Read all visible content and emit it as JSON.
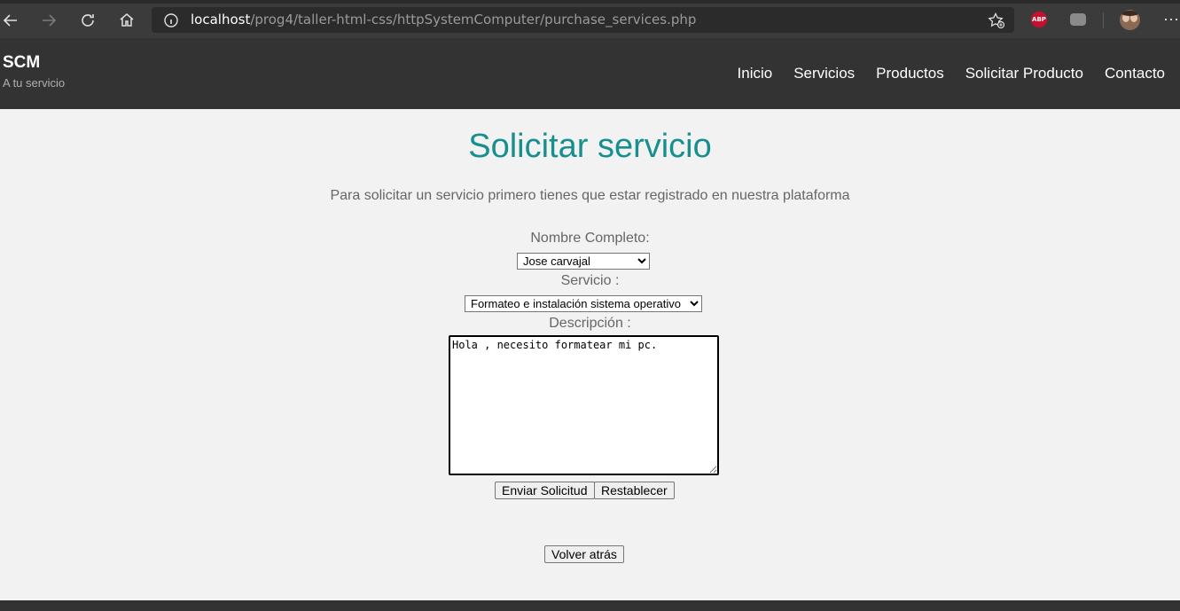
{
  "browser": {
    "url_host": "localhost",
    "url_path": "/prog4/taller-html-css/httpSystemComputer/purchase_services.php",
    "abp_label": "ABP"
  },
  "site": {
    "brand": "SCM",
    "tagline": "A tu servicio",
    "nav": [
      "Inicio",
      "Servicios",
      "Productos",
      "Solicitar Producto",
      "Contacto"
    ]
  },
  "page": {
    "title": "Solicitar servicio",
    "intro": "Para solicitar un servicio primero tienes que estar registrado en nuestra plataforma"
  },
  "form": {
    "name_label": "Nombre Completo:",
    "name_value": "Jose carvajal",
    "service_label": "Servicio :",
    "service_value": "Formateo e instalación sistema operativo",
    "description_label": "Descripción :",
    "description_value": "Hola , necesito formatear mi pc.",
    "submit_label": "Enviar Solicitud",
    "reset_label": "Restablecer",
    "back_label": "Volver atrás"
  },
  "colors": {
    "title": "#178f8f",
    "header_bg": "#333333",
    "page_bg": "#f2f2f2"
  }
}
